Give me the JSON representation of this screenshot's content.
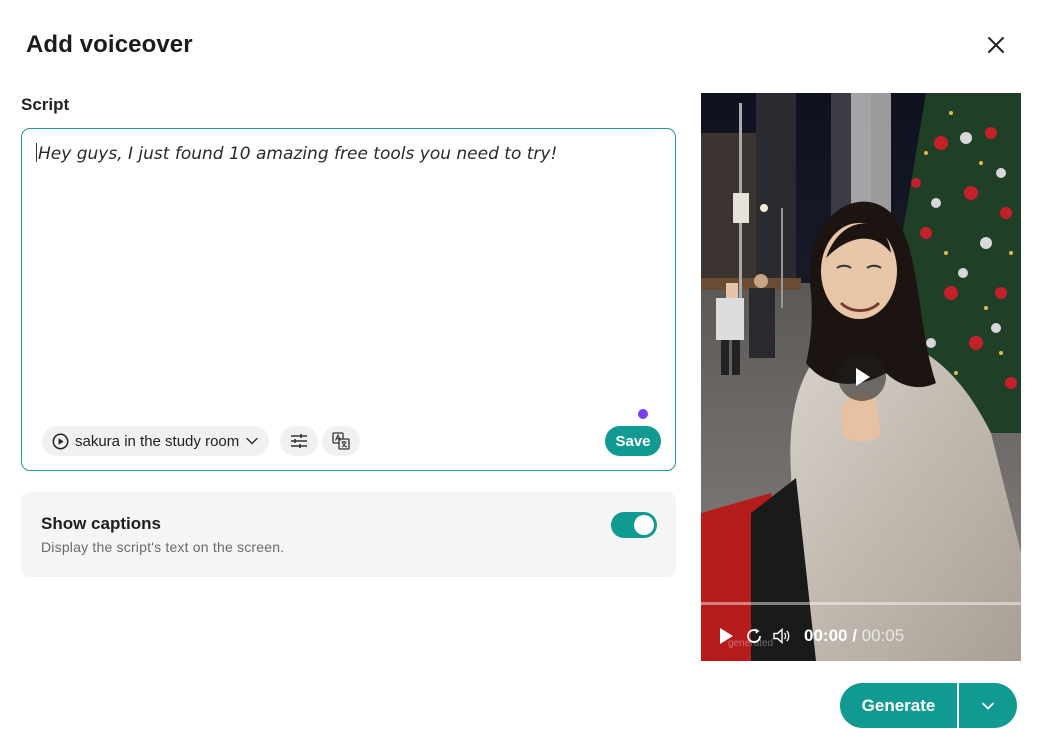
{
  "dialog": {
    "title": "Add voiceover",
    "close_icon": "close-icon"
  },
  "script": {
    "label": "Script",
    "text": "Hey guys, I just found 10 amazing free tools you need to try!",
    "voice": {
      "name": "sakura in the study room",
      "play_icon": "play-circle-icon",
      "chevron_icon": "chevron-down-icon"
    },
    "settings_icon": "sliders-icon",
    "translate_icon": "translate-icon",
    "save_label": "Save"
  },
  "captions": {
    "title": "Show captions",
    "description": "Display the script's text on the screen.",
    "enabled": true
  },
  "video": {
    "current_time": "00:00",
    "separator": " / ",
    "duration": "00:05",
    "progress": 0.0,
    "watermark": "generated"
  },
  "footer": {
    "generate_label": "Generate",
    "more_icon": "chevron-down-icon"
  },
  "colors": {
    "accent": "#109a92",
    "dot": "#7a3df0"
  }
}
